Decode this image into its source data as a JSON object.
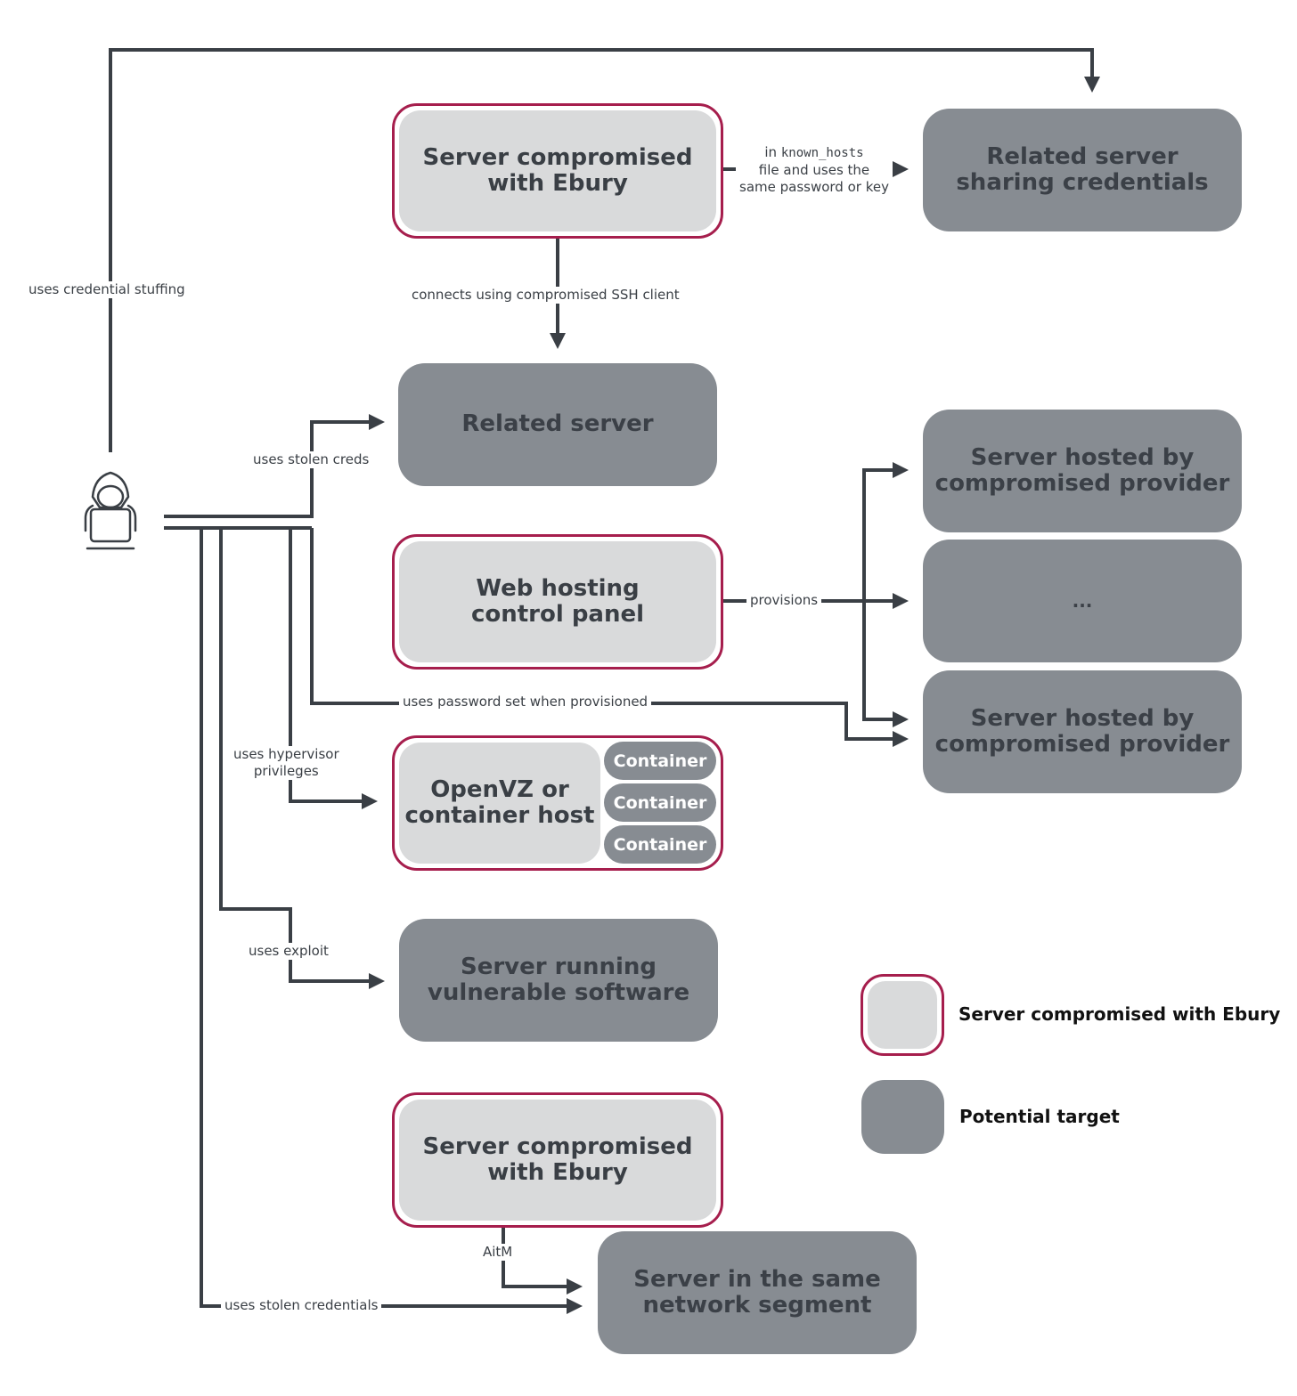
{
  "colors": {
    "compromised_border": "#a61e4d",
    "compromised_fill": "#d9dadb",
    "target_fill": "#878c92",
    "line": "#3a3f45"
  },
  "attacker": {
    "icon": "hooded-hacker-with-laptop-icon"
  },
  "nodes": {
    "ebury_top": {
      "type": "compromised",
      "line1": "Server compromised",
      "line2": "with Ebury"
    },
    "related_sharing": {
      "type": "target",
      "line1": "Related server",
      "line2": "sharing credentials"
    },
    "related_server": {
      "type": "target",
      "line1": "Related server"
    },
    "hosted_1": {
      "type": "target",
      "line1": "Server hosted by",
      "line2": "compromised provider"
    },
    "hosted_ellipsis": {
      "type": "target",
      "line1": "..."
    },
    "hosted_2": {
      "type": "target",
      "line1": "Server hosted by",
      "line2": "compromised provider"
    },
    "web_panel": {
      "type": "compromised",
      "line1": "Web hosting",
      "line2": "control panel"
    },
    "openvz": {
      "type": "compromised",
      "line1": "OpenVZ or",
      "line2": "container host",
      "containers": [
        "Container",
        "Container",
        "Container"
      ]
    },
    "vuln_server": {
      "type": "target",
      "line1": "Server running",
      "line2": "vulnerable software"
    },
    "ebury_bottom": {
      "type": "compromised",
      "line1": "Server compromised",
      "line2": "with Ebury"
    },
    "same_segment": {
      "type": "target",
      "line1": "Server in the same",
      "line2": "network segment"
    }
  },
  "edges": {
    "credential_stuffing": "uses credential stuffing",
    "known_hosts_prefix": "in",
    "known_hosts_code": "known_hosts",
    "known_hosts_line2": "file and uses the",
    "known_hosts_line3": "same password or key",
    "ssh_client": "connects using compromised SSH client",
    "stolen_creds": "uses stolen creds",
    "provisions": "provisions",
    "password_provisioned": "uses password set when provisioned",
    "hypervisor_line1": "uses hypervisor",
    "hypervisor_line2": "privileges",
    "exploit": "uses exploit",
    "aitm": "AitM",
    "stolen_credentials": "uses stolen credentials"
  },
  "legend": {
    "compromised": "Server compromised with Ebury",
    "target": "Potential target"
  }
}
